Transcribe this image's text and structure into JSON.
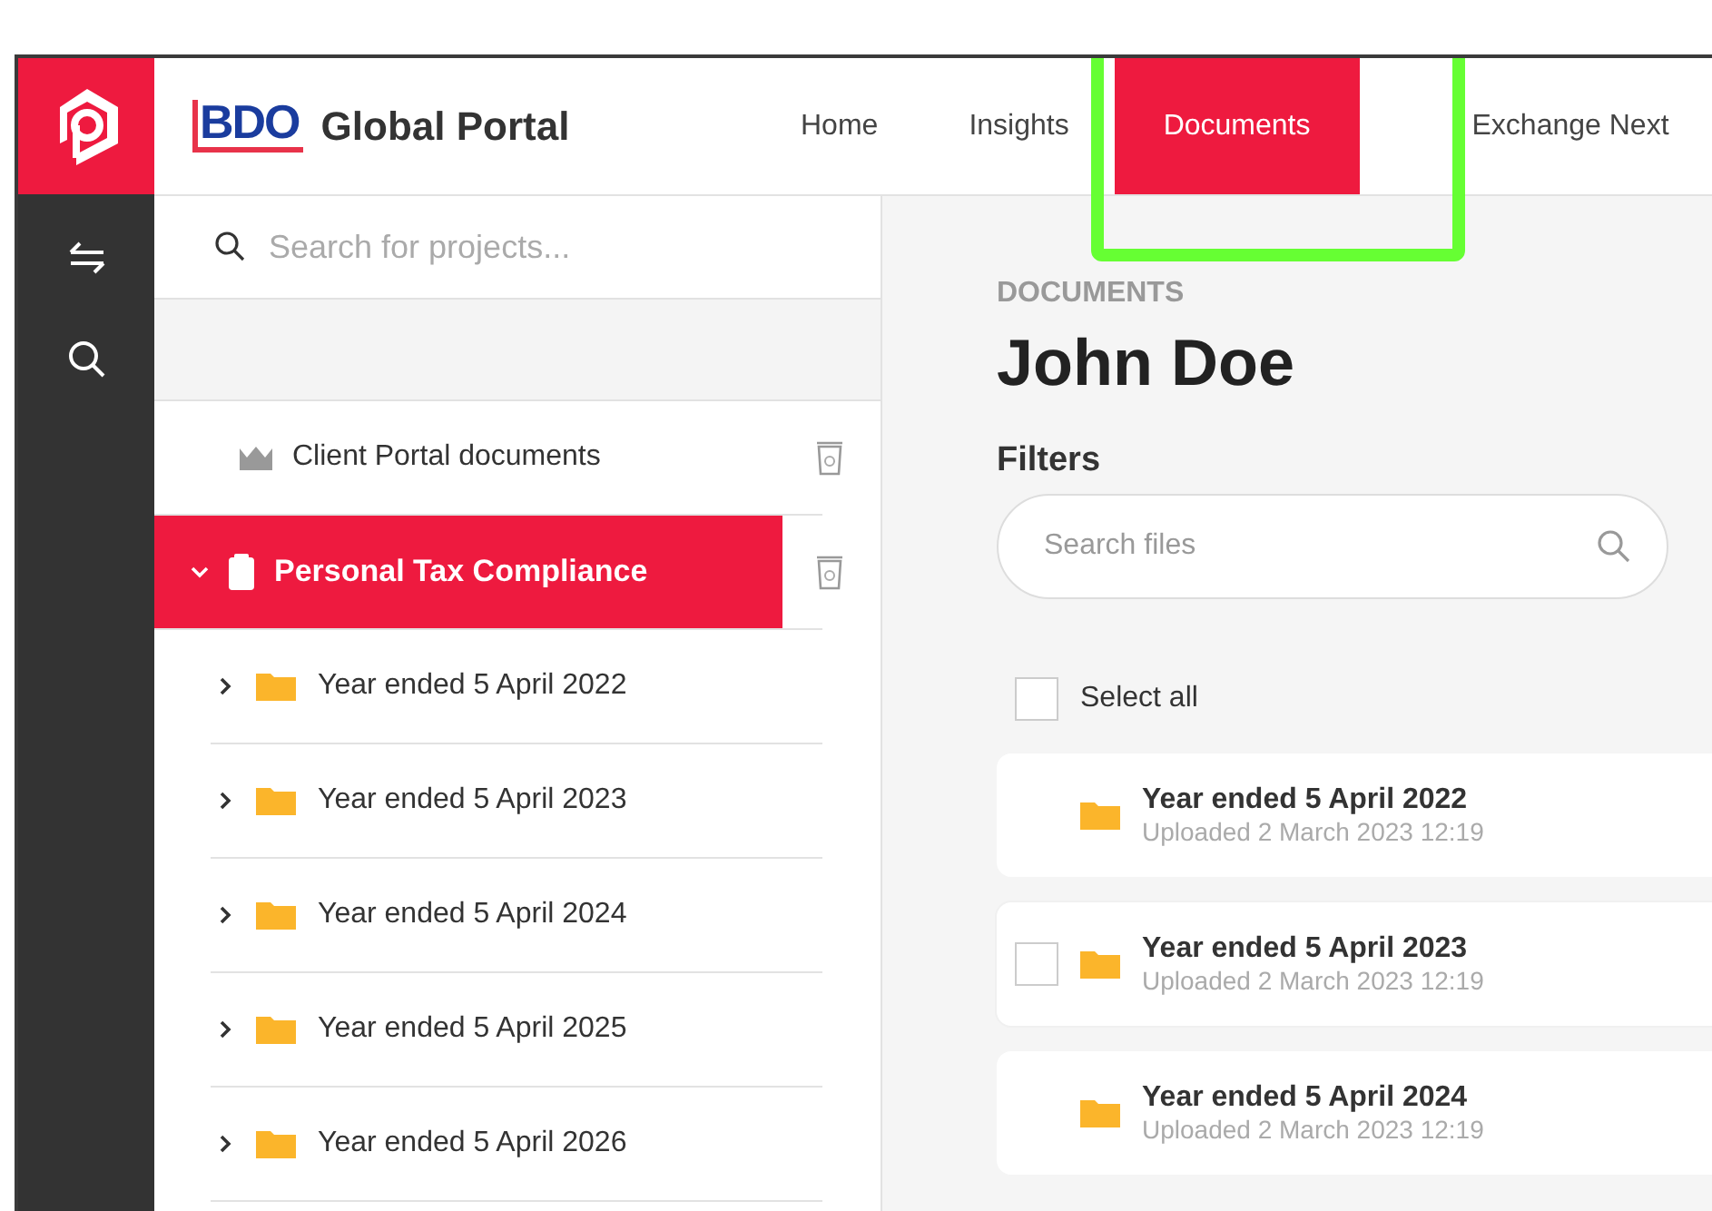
{
  "header": {
    "brand": "BDO",
    "title": "Global Portal",
    "nav": [
      {
        "label": "Home",
        "selected": false
      },
      {
        "label": "Insights",
        "selected": false
      },
      {
        "label": "Documents",
        "selected": true
      },
      {
        "label": "Exchange Next",
        "selected": false
      }
    ]
  },
  "sidebar": {
    "search": {
      "placeholder": "Search for projects..."
    },
    "tree": [
      {
        "kind": "portal",
        "label": "Client Portal documents",
        "selected": false
      },
      {
        "kind": "project",
        "label": "Personal Tax Compliance",
        "selected": true,
        "expanded": true,
        "children": [
          {
            "kind": "folder",
            "label": "Year ended 5 April 2022",
            "selected": false,
            "expanded": false
          },
          {
            "kind": "folder",
            "label": "Year ended 5 April 2023",
            "selected": false,
            "expanded": false
          },
          {
            "kind": "folder",
            "label": "Year ended 5 April 2024",
            "selected": false,
            "expanded": false
          },
          {
            "kind": "folder",
            "label": "Year ended 5 April 2025",
            "selected": false,
            "expanded": false
          },
          {
            "kind": "folder",
            "label": "Year ended 5 April 2026",
            "selected": false,
            "expanded": false
          }
        ]
      }
    ]
  },
  "main": {
    "eyebrow": "DOCUMENTS",
    "title": "John Doe",
    "filters_label": "Filters",
    "search": {
      "placeholder": "Search files"
    },
    "select_all": {
      "label": "Select all",
      "checked": false
    },
    "files": [
      {
        "name": "Year ended 5 April 2022",
        "meta": "Uploaded 2 March 2023 12:19",
        "hovered": false,
        "checked": false
      },
      {
        "name": "Year ended 5 April 2023",
        "meta": "Uploaded 2 March 2023 12:19",
        "hovered": true,
        "checked": false
      },
      {
        "name": "Year ended 5 April 2024",
        "meta": "Uploaded 2 March 2023 12:19",
        "hovered": false,
        "checked": false
      }
    ]
  }
}
